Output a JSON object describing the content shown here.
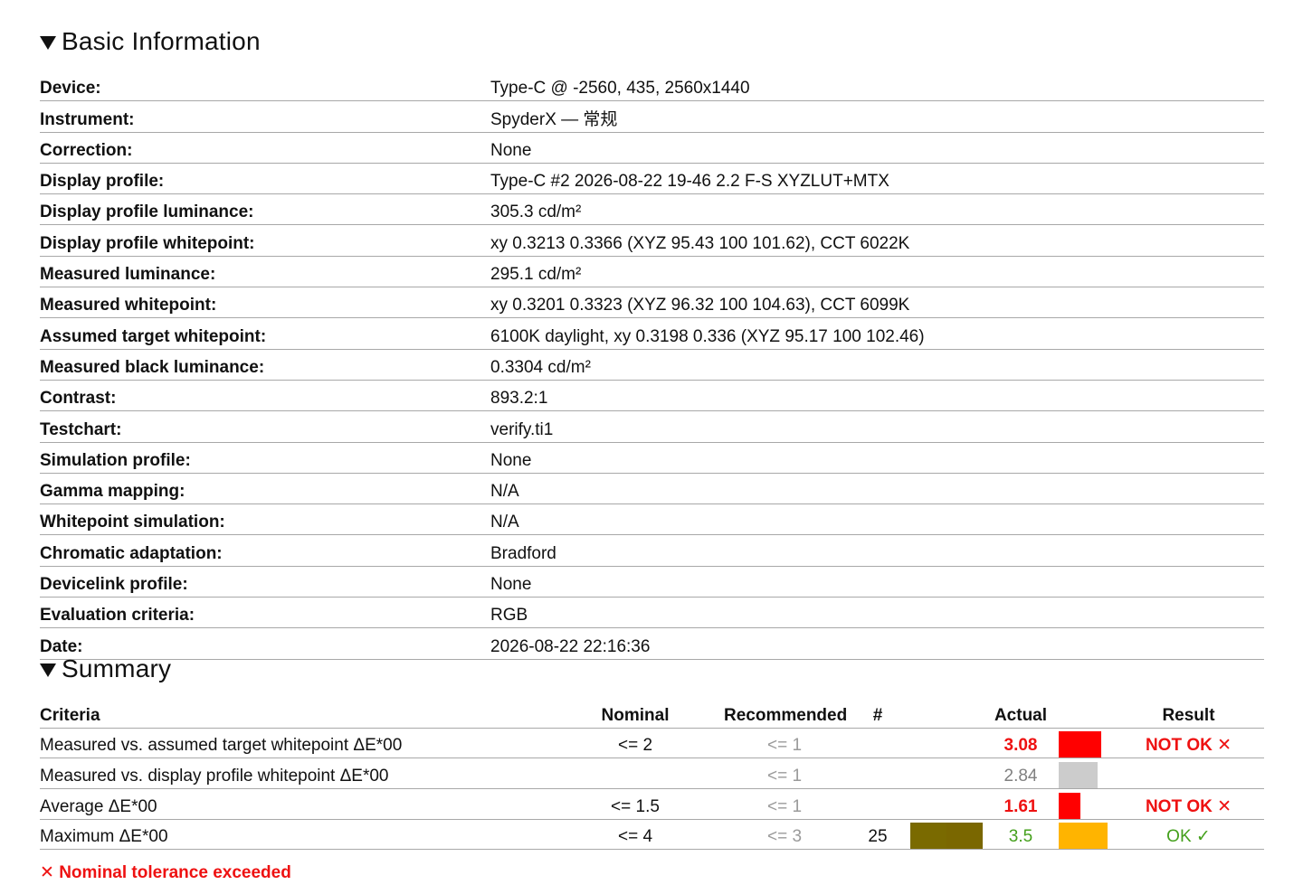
{
  "basic": {
    "title": "Basic Information",
    "rows": [
      {
        "label": "Device:",
        "value": "Type-C @ -2560, 435, 2560x1440"
      },
      {
        "label": "Instrument:",
        "value": "SpyderX — 常规"
      },
      {
        "label": "Correction:",
        "value": "None"
      },
      {
        "label": "Display profile:",
        "value": "Type-C #2 2026-08-22 19-46 2.2 F-S XYZLUT+MTX"
      },
      {
        "label": "Display profile luminance:",
        "value": "305.3 cd/m²"
      },
      {
        "label": "Display profile whitepoint:",
        "value": "xy 0.3213 0.3366 (XYZ 95.43 100 101.62), CCT 6022K"
      },
      {
        "label": "Measured luminance:",
        "value": "295.1 cd/m²"
      },
      {
        "label": "Measured whitepoint:",
        "value": "xy 0.3201 0.3323 (XYZ 96.32 100 104.63), CCT 6099K"
      },
      {
        "label": "Assumed target whitepoint:",
        "value": "6100K daylight, xy 0.3198 0.336 (XYZ 95.17 100 102.46)"
      },
      {
        "label": "Measured black luminance:",
        "value": "0.3304 cd/m²"
      },
      {
        "label": "Contrast:",
        "value": "893.2:1"
      },
      {
        "label": "Testchart:",
        "value": "verify.ti1"
      },
      {
        "label": "Simulation profile:",
        "value": "None"
      },
      {
        "label": "Gamma mapping:",
        "value": "N/A"
      },
      {
        "label": "Whitepoint simulation:",
        "value": "N/A"
      },
      {
        "label": "Chromatic adaptation:",
        "value": "Bradford"
      },
      {
        "label": "Devicelink profile:",
        "value": "None"
      },
      {
        "label": "Evaluation criteria:",
        "value": "RGB"
      },
      {
        "label": "Date:",
        "value": "2026-08-22 22:16:36"
      }
    ]
  },
  "summary": {
    "title": "Summary",
    "headers": {
      "criteria": "Criteria",
      "nominal": "Nominal",
      "recommended": "Recommended",
      "count": "#",
      "actual": "Actual",
      "result": "Result"
    },
    "rows": [
      {
        "criteria": "Measured vs. assumed target whitepoint ΔE*00",
        "nominal": "<= 2",
        "recommended": "<= 1",
        "count": "",
        "actual": "3.08",
        "actual_status": "bad",
        "bar_color": "#ff0000",
        "bar_fraction": 0.78,
        "result": "NOT OK ✕",
        "result_status": "bad"
      },
      {
        "criteria": "Measured vs. display profile whitepoint ΔE*00",
        "nominal": "",
        "recommended": "<= 1",
        "count": "",
        "actual": "2.84",
        "actual_status": "neutral",
        "bar_color": "#cccccc",
        "bar_fraction": 0.72,
        "result": "",
        "result_status": "none"
      },
      {
        "criteria": "Average ΔE*00",
        "nominal": "<= 1.5",
        "recommended": "<= 1",
        "count": "",
        "actual": "1.61",
        "actual_status": "bad",
        "bar_color": "#ff0000",
        "bar_fraction": 0.4,
        "result": "NOT OK ✕",
        "result_status": "bad"
      },
      {
        "criteria": "Maximum ΔE*00",
        "nominal": "<= 4",
        "recommended": "<= 3",
        "count": "25",
        "swatch_colors": [
          "#7a6a00",
          "#7a6700"
        ],
        "actual": "3.5",
        "actual_status": "ok",
        "bar_color": "#ffb400",
        "bar_fraction": 0.9,
        "result": "OK ✓",
        "result_status": "ok"
      }
    ],
    "footnote": "✕ Nominal tolerance exceeded"
  }
}
